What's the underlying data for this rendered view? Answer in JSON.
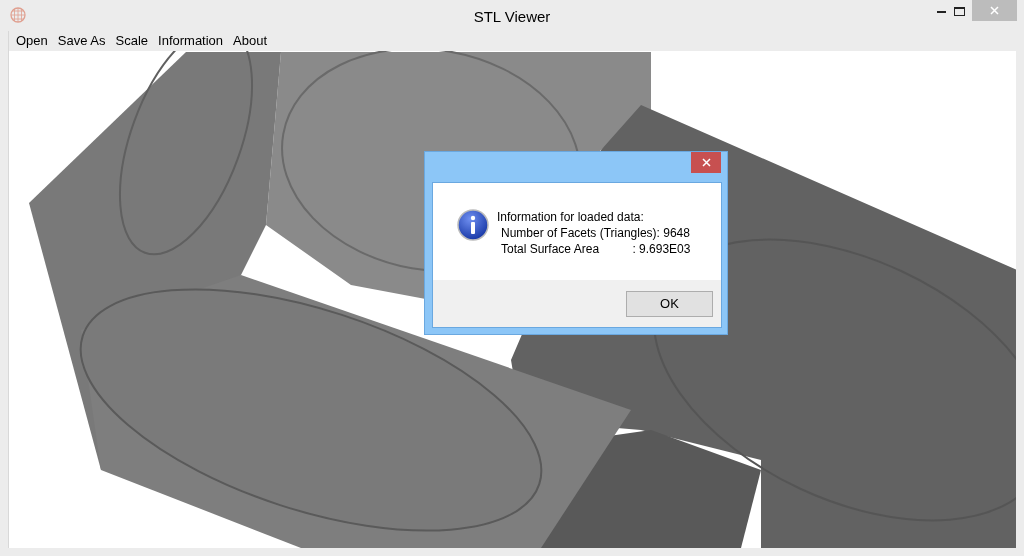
{
  "window": {
    "title": "STL Viewer"
  },
  "menu": [
    "Open",
    "Save As",
    "Scale",
    "Information",
    "About"
  ],
  "dialog": {
    "lines": [
      "Information for loaded data:",
      "Number of Facets (Triangles): 9648",
      "Total Surface Area          : 9.693E03"
    ],
    "button": "OK"
  }
}
